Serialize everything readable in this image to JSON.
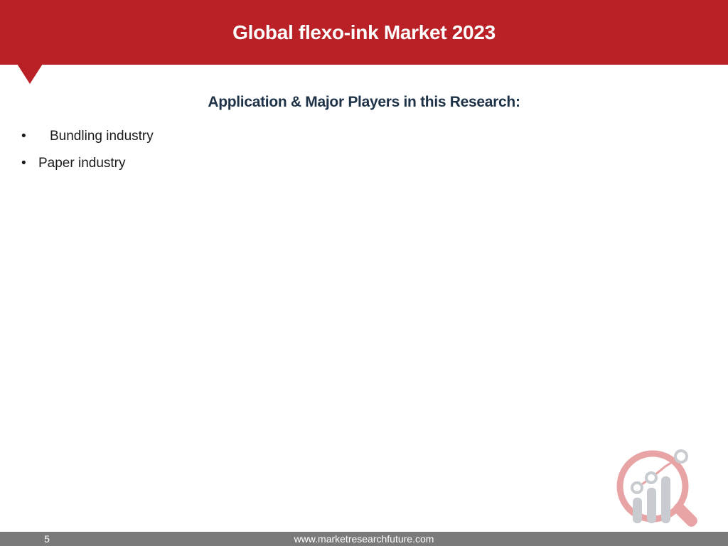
{
  "header": {
    "title": "Global flexo-ink  Market 2023",
    "color": "#b92126"
  },
  "main": {
    "heading": "Application & Major Players in this Research:",
    "heading_color": "#1d3147",
    "bullets": [
      {
        "marker": "•",
        "label": "Bundling industry"
      },
      {
        "marker": "•",
        "label": "Paper industry"
      }
    ]
  },
  "logo": {
    "icon": "magnifier-bar-chart-logo-icon",
    "colors": {
      "ring": "#e8a3a5",
      "bars": "#c8ccd0",
      "line": "#e8a3a5"
    }
  },
  "footer": {
    "page_number": "5",
    "url": "www.marketresearchfuture.com",
    "color": "#7a7a7a"
  }
}
